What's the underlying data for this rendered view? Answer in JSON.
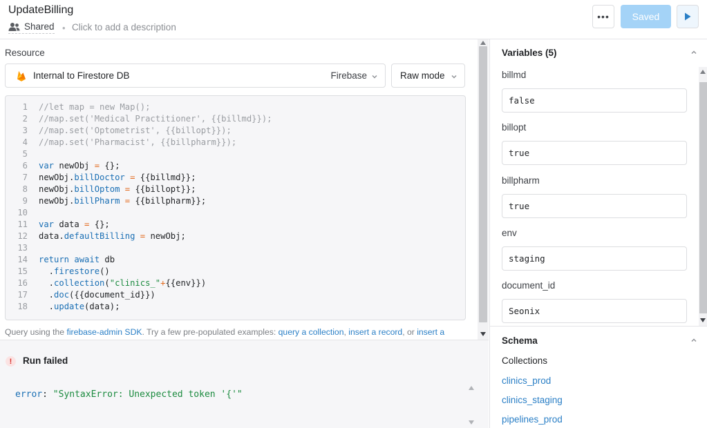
{
  "header": {
    "title": "UpdateBilling",
    "shared_label": "Shared",
    "separator": "•",
    "description_placeholder": "Click to add a description",
    "more_label": "•••",
    "saved_label": "Saved"
  },
  "resource": {
    "label": "Resource",
    "name": "Internal to Firestore DB",
    "type": "Firebase",
    "mode": "Raw mode"
  },
  "editor": {
    "lines": [
      {
        "n": "1",
        "text": "//let map = new Map();"
      },
      {
        "n": "2",
        "text": "//map.set('Medical Practitioner', {{billmd}});"
      },
      {
        "n": "3",
        "text": "//map.set('Optometrist', {{billopt}});"
      },
      {
        "n": "4",
        "text": "//map.set('Pharmacist', {{billpharm}});"
      },
      {
        "n": "5",
        "text": ""
      },
      {
        "n": "6",
        "text": "var newObj = {};"
      },
      {
        "n": "7",
        "text": "newObj.billDoctor = {{billmd}};"
      },
      {
        "n": "8",
        "text": "newObj.billOptom = {{billopt}};"
      },
      {
        "n": "9",
        "text": "newObj.billPharm = {{billpharm}};"
      },
      {
        "n": "10",
        "text": ""
      },
      {
        "n": "11",
        "text": "var data = {};"
      },
      {
        "n": "12",
        "text": "data.defaultBilling = newObj;"
      },
      {
        "n": "13",
        "text": ""
      },
      {
        "n": "14",
        "text": "return await db"
      },
      {
        "n": "15",
        "text": "  .firestore()"
      },
      {
        "n": "16",
        "text": "  .collection(\"clinics_\"+{{env}})"
      },
      {
        "n": "17",
        "text": "  .doc({{document_id}})"
      },
      {
        "n": "18",
        "text": "  .update(data);"
      }
    ]
  },
  "helper": {
    "prefix": "Query using the ",
    "sdk_link": "firebase-admin SDK",
    "middle": ". Try a few pre-populated examples: ",
    "link1": "query a collection",
    "sep1": ", ",
    "link2": "insert a record",
    "sep2": ", or ",
    "link3": "insert a"
  },
  "console": {
    "status_icon": "!",
    "status": "Run failed",
    "error_key": "error",
    "error_colon": ": ",
    "error_value": "\"SyntaxError: Unexpected token '{'\""
  },
  "variables": {
    "title": "Variables (5)",
    "items": [
      {
        "label": "billmd",
        "value": "false"
      },
      {
        "label": "billopt",
        "value": "true"
      },
      {
        "label": "billpharm",
        "value": "true"
      },
      {
        "label": "env",
        "value": "staging"
      },
      {
        "label": "document_id",
        "value": "Seonix"
      }
    ]
  },
  "schema": {
    "title": "Schema",
    "subtitle": "Collections",
    "collections": [
      "clinics_prod",
      "clinics_staging",
      "pipelines_prod"
    ]
  },
  "colors": {
    "accent": "#2a7fc6",
    "saved_button": "#a4d3f7",
    "error": "#d9302c",
    "string": "#1a8a3e"
  }
}
